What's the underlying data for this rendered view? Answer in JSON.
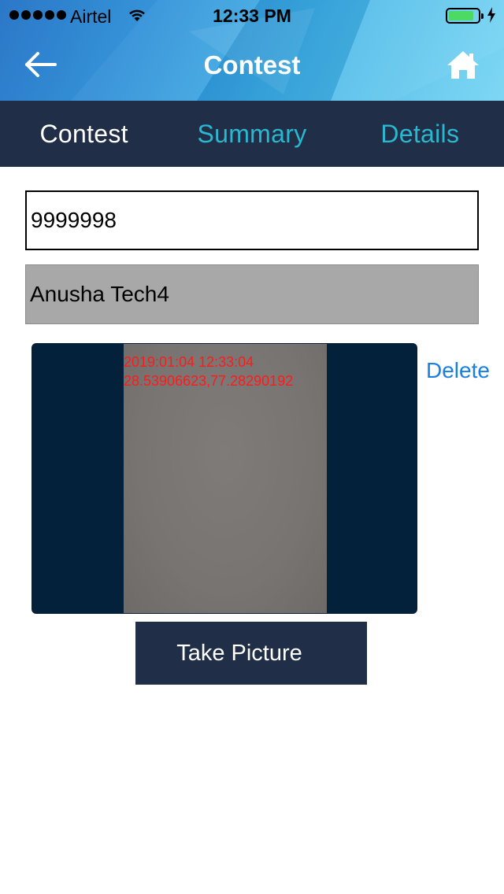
{
  "status_bar": {
    "carrier": "Airtel",
    "time": "12:33 PM",
    "battery_level": 0.85
  },
  "nav": {
    "title": "Contest",
    "back_icon": "back-arrow-icon",
    "home_icon": "home-icon"
  },
  "tabs": [
    {
      "label": "Contest",
      "color": "#ffffff"
    },
    {
      "label": "Summary",
      "color": "#2ab7d0"
    },
    {
      "label": "Details",
      "color": "#2ab7d0"
    }
  ],
  "form": {
    "id_value": "9999998",
    "name_value": "Anusha Tech4"
  },
  "photo": {
    "timestamp": "2019:01:04 12:33:04",
    "coordinates": "28.53906623,77.28290192",
    "delete_label": "Delete"
  },
  "actions": {
    "take_picture_label": "Take Picture"
  },
  "colors": {
    "tabbar_bg": "#212e48",
    "accent_link": "#1a7fe0",
    "photo_stamp": "#ff1a1a"
  }
}
